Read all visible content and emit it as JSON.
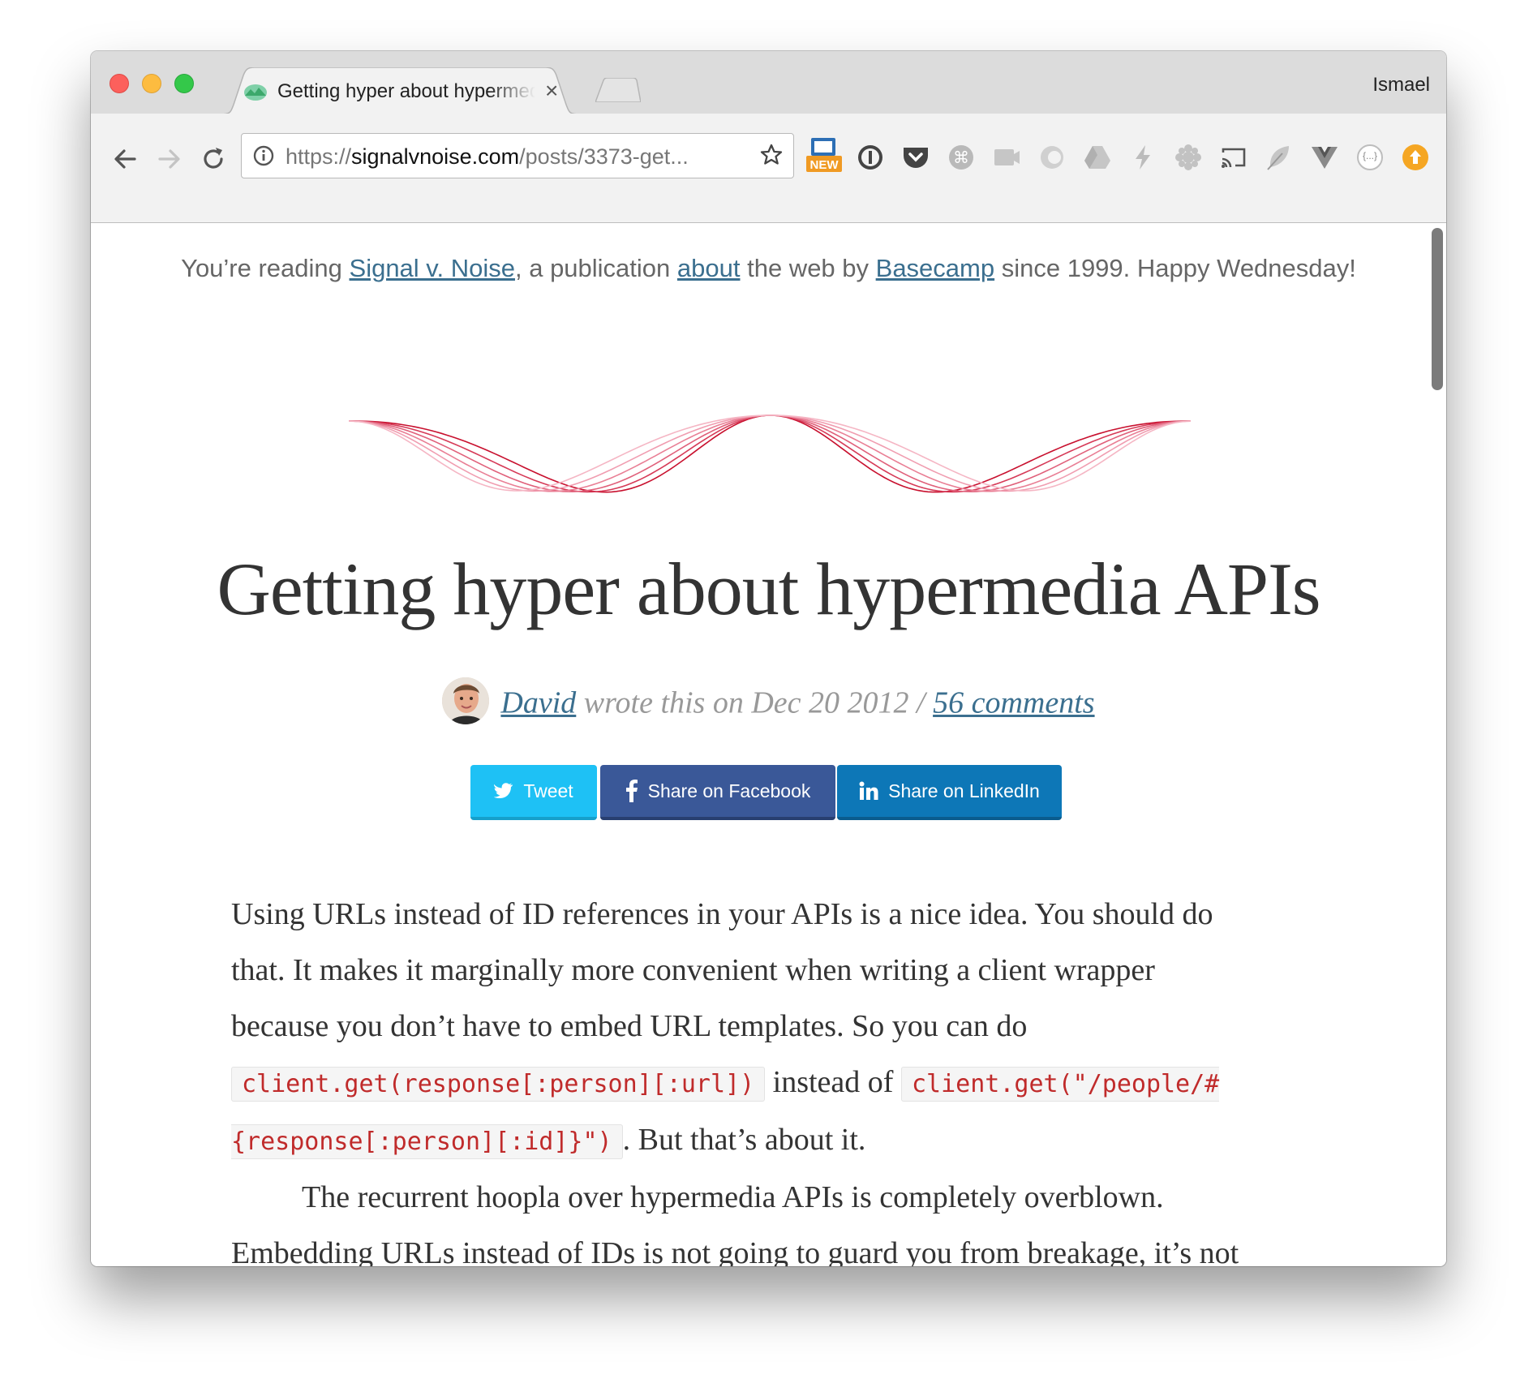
{
  "browser": {
    "profile_name": "Ismael",
    "tab": {
      "title": "Getting hyper about hypermedia APIs",
      "close_label": "×"
    },
    "address": {
      "scheme": "https://",
      "host": "signalvnoise.com",
      "path": "/posts/3373-get..."
    },
    "extensions": [
      "new-badge-icon",
      "onepassword-icon",
      "pocket-icon",
      "command-icon",
      "screencast-icon",
      "eye-icon",
      "drive-icon",
      "bolt-icon",
      "gear-flower-icon",
      "cast-icon",
      "feather-icon",
      "vue-icon",
      "json-icon",
      "upload-icon"
    ],
    "new_badge_text": "NEW",
    "json_ext_text": "{...}"
  },
  "page": {
    "banner": {
      "prefix": "You’re reading ",
      "link_publication": "Signal v. Noise",
      "middle1": ", a publication ",
      "link_about": "about",
      "middle2": " the web by ",
      "link_company": "Basecamp",
      "suffix": " since 1999. Happy Wednesday!"
    },
    "title": "Getting hyper about hypermedia APIs",
    "byline": {
      "author": "David",
      "middle": " wrote this on Dec 20 2012 / ",
      "comments": "56 comments"
    },
    "share": {
      "tweet": "Tweet",
      "facebook": "Share on Facebook",
      "linkedin": "Share on LinkedIn"
    },
    "article": {
      "p1_text1": "Using URLs instead of ID references in your APIs is a nice idea. You should do that. It makes it marginally more convenient when writing a client wrapper because you don’t have to embed URL templates. So you can do ",
      "p1_code1": "client.get(response[:person][:url])",
      "p1_text2": " instead of ",
      "p1_code2": "client.get(\"/people/#{response[:person][:id]}\")",
      "p1_text3": ". But that’s about it.",
      "p2_text": "The recurrent hoopla over hypermedia APIs is completely overblown. Embedding URLs instead of IDs is not going to guard you from breakage, it’s not going to do anything materially useful for standardizing API clients, and"
    }
  }
}
